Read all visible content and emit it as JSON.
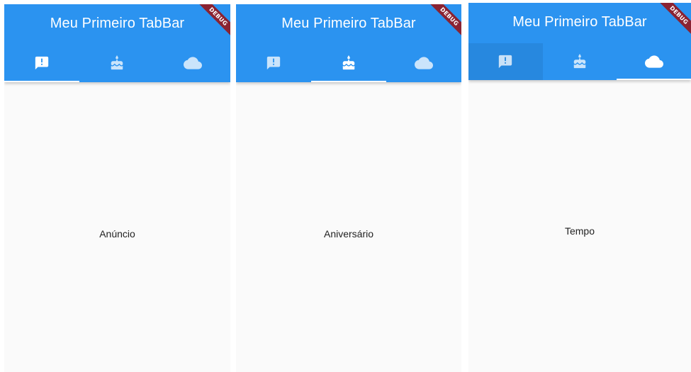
{
  "colors": {
    "primary": "#2b93f0",
    "indicator": "#ffffff",
    "debug_ribbon": "#8a2332",
    "body_background": "#fafafa"
  },
  "screens": [
    {
      "title": "Meu Primeiro TabBar",
      "debug_label": "DEBUG",
      "active_tab": "announcement",
      "tabs": [
        {
          "icon": "announcement-icon"
        },
        {
          "icon": "cake-icon"
        },
        {
          "icon": "cloud-icon"
        }
      ],
      "body_text": "Anúncio"
    },
    {
      "title": "Meu Primeiro TabBar",
      "debug_label": "DEBUG",
      "active_tab": "cake",
      "tabs": [
        {
          "icon": "announcement-icon"
        },
        {
          "icon": "cake-icon"
        },
        {
          "icon": "cloud-icon"
        }
      ],
      "body_text": "Aniversário"
    },
    {
      "title": "Meu Primeiro TabBar",
      "debug_label": "DEBUG",
      "active_tab": "cloud",
      "tabs": [
        {
          "icon": "announcement-icon"
        },
        {
          "icon": "cake-icon"
        },
        {
          "icon": "cloud-icon"
        }
      ],
      "body_text": "Tempo"
    }
  ]
}
